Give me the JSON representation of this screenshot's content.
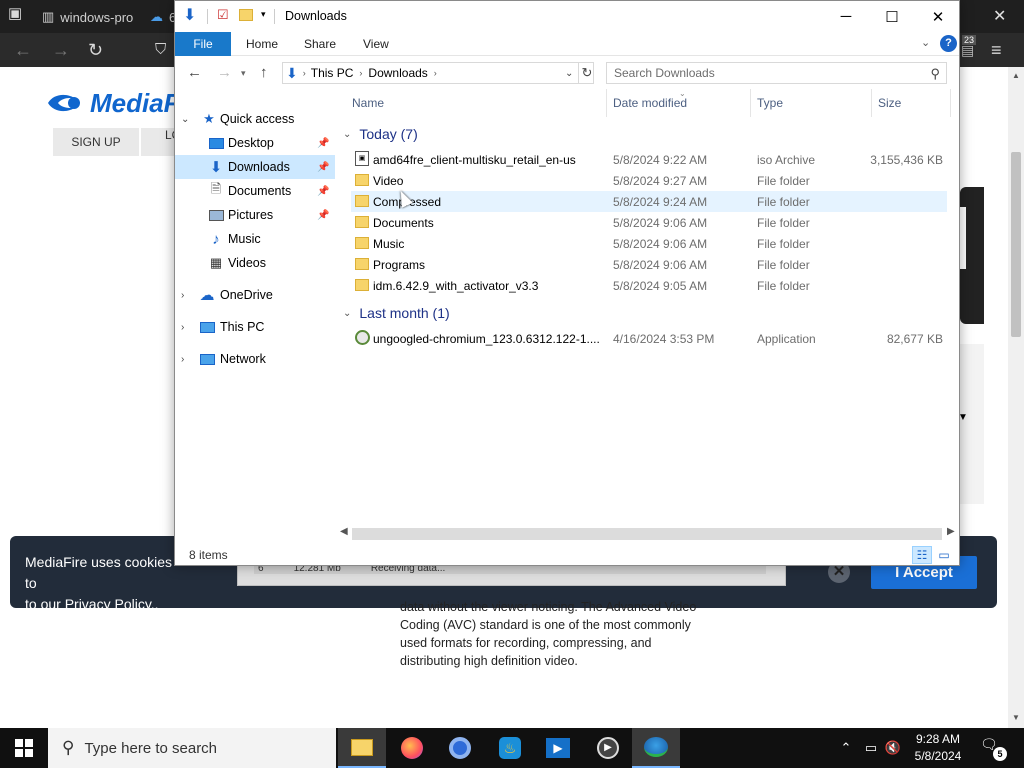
{
  "browser": {
    "tabs": [
      {
        "label": "windows-pro"
      },
      {
        "label": "6"
      }
    ],
    "badge_count": "23"
  },
  "mediafire": {
    "logo": "MediaFire",
    "signup": "SIGN UP",
    "login": "LO",
    "cookie_text": "MediaFire uses cookies to p... to our Privacy Policy..",
    "cookie_line1": "MediaFire uses cookies to",
    "cookie_line2": "to our Privacy Policy..",
    "accept": "I Accept",
    "download_strip": {
      "col1": "6",
      "col2": "12.281 Mb",
      "col3": "Receiving data..."
    },
    "article_lines": [
      "data without the viewer noticing. The Advanced Video",
      "Coding (AVC) standard is one of the most commonly",
      "used formats for recording, compressing, and",
      "distributing high definition video."
    ]
  },
  "explorer": {
    "title": "Downloads",
    "ribbon": {
      "file": "File",
      "home": "Home",
      "share": "Share",
      "view": "View"
    },
    "address": {
      "segments": [
        "This PC",
        "Downloads"
      ]
    },
    "search_placeholder": "Search Downloads",
    "nav": {
      "quick_access": "Quick access",
      "desktop": "Desktop",
      "downloads": "Downloads",
      "documents": "Documents",
      "pictures": "Pictures",
      "music": "Music",
      "videos": "Videos",
      "onedrive": "OneDrive",
      "this_pc": "This PC",
      "network": "Network"
    },
    "columns": {
      "name": "Name",
      "date": "Date modified",
      "type": "Type",
      "size": "Size"
    },
    "groups": [
      {
        "label": "Today (7)",
        "items": [
          {
            "name": "amd64fre_client-multisku_retail_en-us",
            "date": "5/8/2024 9:22 AM",
            "type": "iso Archive",
            "size": "3,155,436 KB",
            "icon": "iso-file-icon"
          },
          {
            "name": "Video",
            "date": "5/8/2024 9:27 AM",
            "type": "File folder",
            "size": "",
            "icon": "folder-icon"
          },
          {
            "name": "Compressed",
            "date": "5/8/2024 9:24 AM",
            "type": "File folder",
            "size": "",
            "icon": "folder-icon"
          },
          {
            "name": "Documents",
            "date": "5/8/2024 9:06 AM",
            "type": "File folder",
            "size": "",
            "icon": "folder-icon"
          },
          {
            "name": "Music",
            "date": "5/8/2024 9:06 AM",
            "type": "File folder",
            "size": "",
            "icon": "folder-icon"
          },
          {
            "name": "Programs",
            "date": "5/8/2024 9:06 AM",
            "type": "File folder",
            "size": "",
            "icon": "folder-icon"
          },
          {
            "name": "idm.6.42.9_with_activator_v3.3",
            "date": "5/8/2024 9:05 AM",
            "type": "File folder",
            "size": "",
            "icon": "folder-icon"
          }
        ]
      },
      {
        "label": "Last month (1)",
        "items": [
          {
            "name": "ungoogled-chromium_123.0.6312.122-1....",
            "date": "4/16/2024 3:53 PM",
            "type": "Application",
            "size": "82,677 KB",
            "icon": "installer-icon"
          }
        ]
      }
    ],
    "status": "8 items"
  },
  "taskbar": {
    "search_placeholder": "Type here to search",
    "time": "9:28 AM",
    "date": "5/8/2024",
    "notification_count": "5"
  },
  "colors": {
    "accent": "#1979ca",
    "selection": "#cce8ff",
    "hover": "#e5f3ff",
    "group_header": "#1e3287",
    "folder": "#f7d46a",
    "cookie_bg": "#222c3a",
    "accept_btn": "#1a6fd6"
  }
}
